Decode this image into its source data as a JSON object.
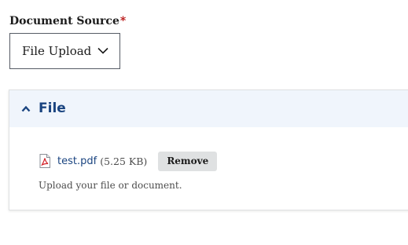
{
  "document_source": {
    "label": "Document Source",
    "required_mark": "*",
    "selected_value": "File Upload"
  },
  "file_section": {
    "title": "File",
    "file": {
      "name": "test.pdf",
      "size": "(5.25 KB)",
      "remove_label": "Remove"
    },
    "help_text": "Upload your file or document."
  },
  "colors": {
    "link": "#1a4480",
    "required": "#b50909",
    "header_bg": "#f0f5fc",
    "button_bg": "#dfe1e2"
  },
  "icons": {
    "select": "chevron-down-icon",
    "section_toggle": "caret-up-icon",
    "file_type": "pdf-file-icon"
  }
}
